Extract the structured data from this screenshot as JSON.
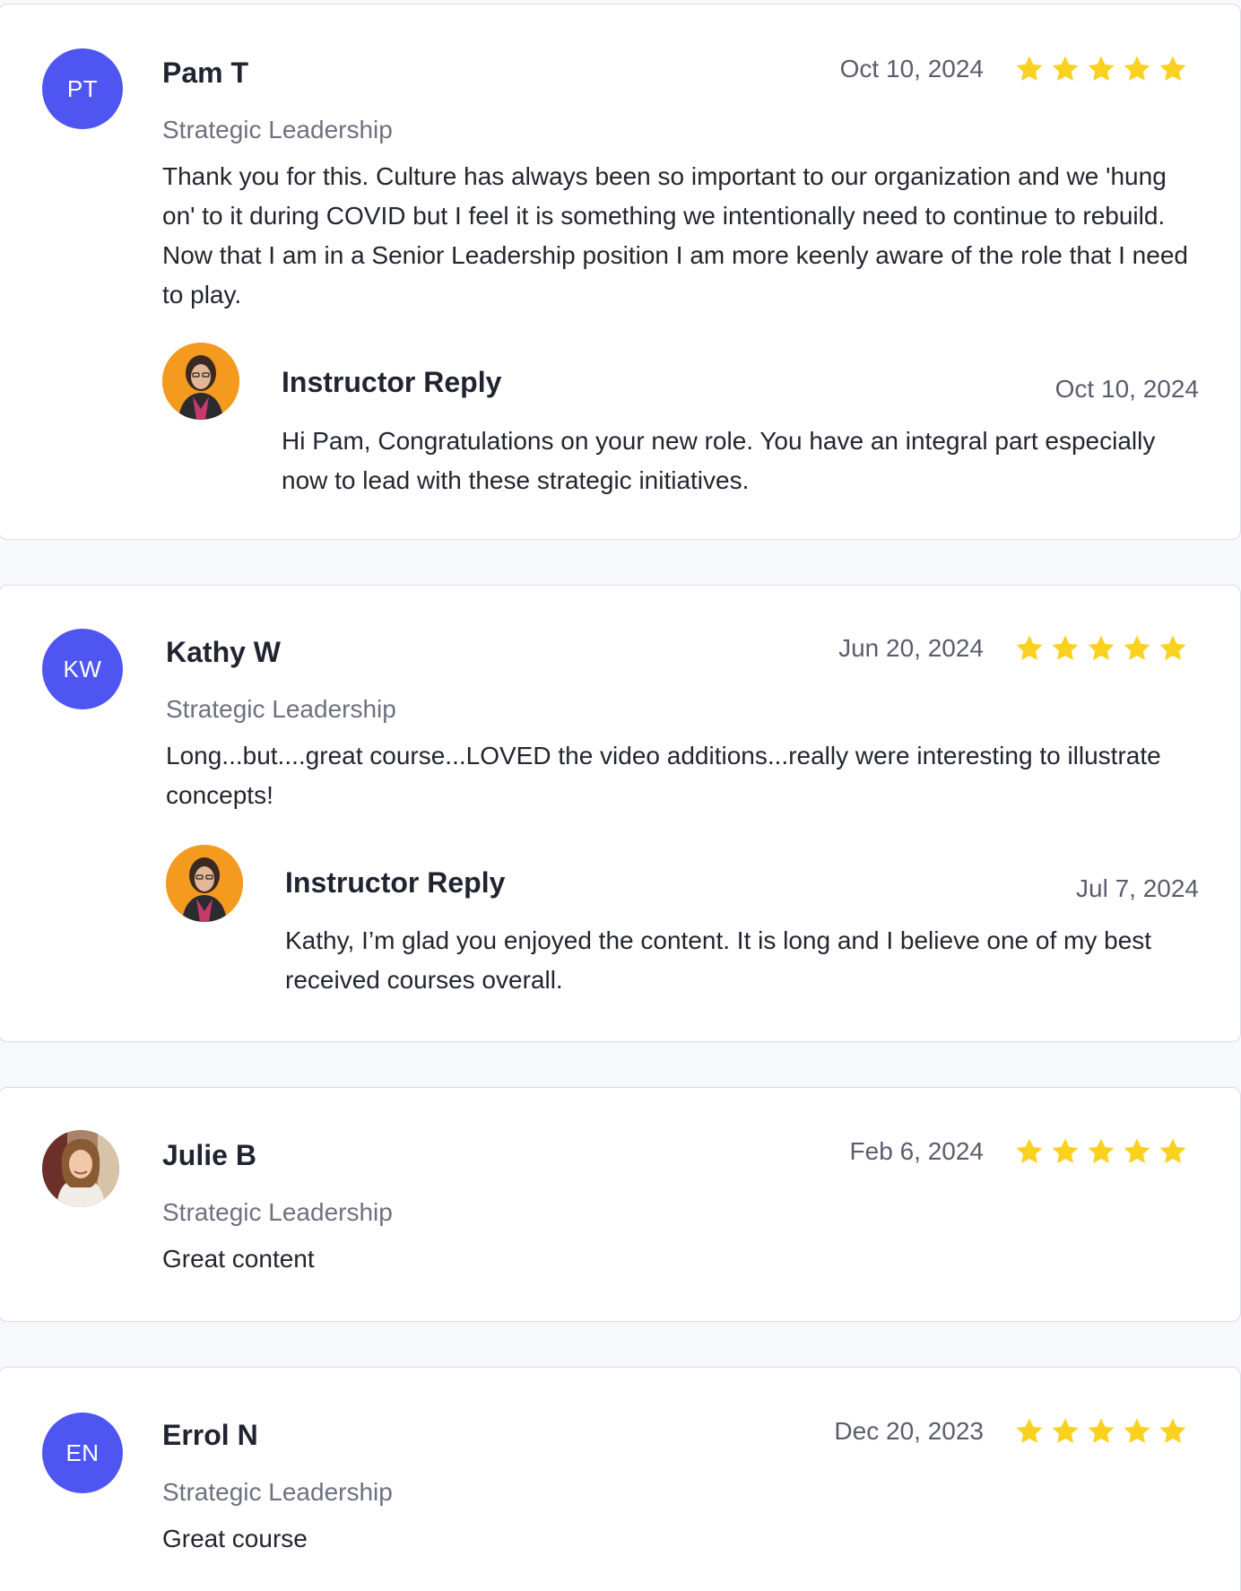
{
  "star_color": "#fbd11f",
  "avatar_color": "#4f55f1",
  "reviews": [
    {
      "initials": "PT",
      "name": "Pam T",
      "date": "Oct 10, 2024",
      "rating": 5,
      "course": "Strategic Leadership",
      "text": "Thank you for this. Culture has always been so important to our organization and we 'hung on' to it during COVID but I feel it is something we intentionally need to continue to rebuild. Now that I am in a Senior Leadership position I am more keenly aware of the role that I need to play.",
      "reply": {
        "title": "Instructor Reply",
        "date": "Oct 10, 2024",
        "text": "Hi Pam, Congratulations on your new role. You have an integral part especially now to lead with these strategic initiatives."
      }
    },
    {
      "initials": "KW",
      "name": "Kathy W",
      "date": "Jun 20, 2024",
      "rating": 5,
      "course": "Strategic Leadership",
      "text": "Long...but....great course...LOVED the video additions...really were interesting to illustrate concepts!",
      "reply": {
        "title": "Instructor Reply",
        "date": "Jul 7, 2024",
        "text": "Kathy, I’m glad you enjoyed the content. It is long and I believe one of my best received courses overall."
      }
    },
    {
      "initials": "",
      "name": "Julie B",
      "date": "Feb 6, 2024",
      "rating": 5,
      "course": "Strategic Leadership",
      "text": "Great content"
    },
    {
      "initials": "EN",
      "name": "Errol N",
      "date": "Dec 20, 2023",
      "rating": 5,
      "course": "Strategic Leadership",
      "text": "Great course"
    }
  ]
}
